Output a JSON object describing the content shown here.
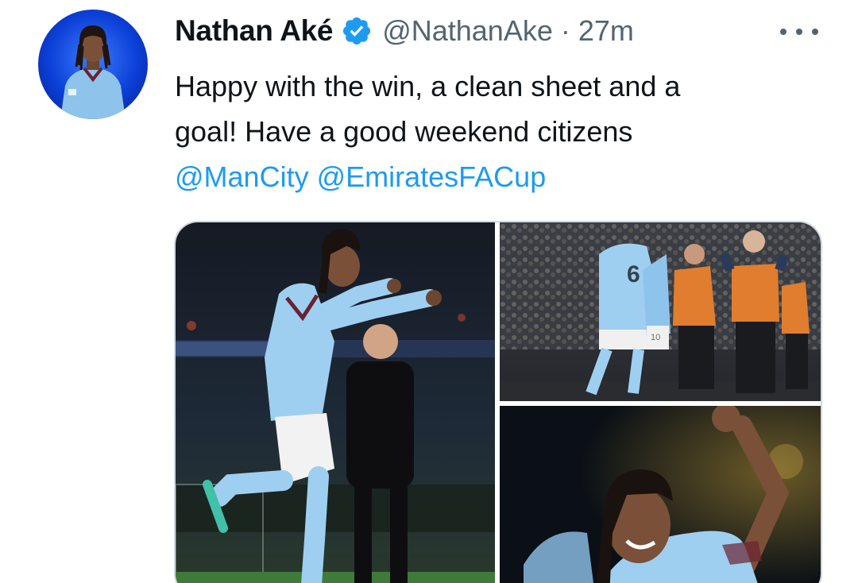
{
  "tweet": {
    "author": {
      "display_name": "Nathan Aké",
      "handle": "@NathanAke",
      "verified": true,
      "avatar_icon": "profile-photo"
    },
    "separator": "·",
    "timestamp": "27m",
    "more_icon": "more-horizontal-icon",
    "text": {
      "line1": "Happy with the win, a clean sheet and a",
      "line2": "goal! Have a good weekend citizens",
      "mentions": [
        "@ManCity",
        "@EmiratesFACup"
      ]
    },
    "media": [
      {
        "kind": "photo",
        "subject": "player celebrating goal"
      },
      {
        "kind": "photo",
        "subject": "team celebration with staff"
      },
      {
        "kind": "photo",
        "subject": "player raising fist"
      }
    ]
  },
  "colors": {
    "link": "#1d9bf0",
    "secondary_text": "#536471",
    "verified_badge": "#1d9bf0",
    "border": "#cfd9de",
    "kit_sky_blue": "#8ec3ec"
  }
}
